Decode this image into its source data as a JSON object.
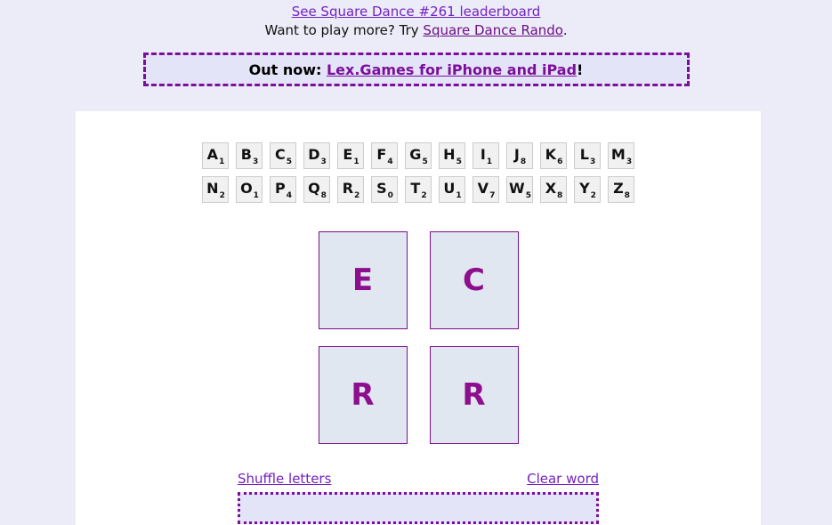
{
  "promo": {
    "leaderboard_link": "See Square Dance #261 leaderboard",
    "play_more_prefix": "Want to play more? Try ",
    "rando_link": "Square Dance Rando",
    "play_more_suffix": ".",
    "banner_prefix": "Out now: ",
    "banner_link": "Lex.Games for iPhone and iPad",
    "banner_suffix": "!"
  },
  "rack": {
    "row1": [
      {
        "letter": "A",
        "value": "1"
      },
      {
        "letter": "B",
        "value": "3"
      },
      {
        "letter": "C",
        "value": "5"
      },
      {
        "letter": "D",
        "value": "3"
      },
      {
        "letter": "E",
        "value": "1"
      },
      {
        "letter": "F",
        "value": "4"
      },
      {
        "letter": "G",
        "value": "5"
      },
      {
        "letter": "H",
        "value": "5"
      },
      {
        "letter": "I",
        "value": "1"
      },
      {
        "letter": "J",
        "value": "8"
      },
      {
        "letter": "K",
        "value": "6"
      },
      {
        "letter": "L",
        "value": "3"
      },
      {
        "letter": "M",
        "value": "3"
      }
    ],
    "row2": [
      {
        "letter": "N",
        "value": "2"
      },
      {
        "letter": "O",
        "value": "1"
      },
      {
        "letter": "P",
        "value": "4"
      },
      {
        "letter": "Q",
        "value": "8"
      },
      {
        "letter": "R",
        "value": "2"
      },
      {
        "letter": "S",
        "value": "0"
      },
      {
        "letter": "T",
        "value": "2"
      },
      {
        "letter": "U",
        "value": "1"
      },
      {
        "letter": "V",
        "value": "7"
      },
      {
        "letter": "W",
        "value": "5"
      },
      {
        "letter": "X",
        "value": "8"
      },
      {
        "letter": "Y",
        "value": "2"
      },
      {
        "letter": "Z",
        "value": "8"
      }
    ]
  },
  "board": {
    "row1": [
      {
        "letter": "E"
      },
      {
        "letter": "C"
      }
    ],
    "row2": [
      {
        "letter": "R"
      },
      {
        "letter": "R"
      }
    ]
  },
  "controls": {
    "shuffle_label": "Shuffle letters",
    "clear_label": "Clear word",
    "word_value": ""
  },
  "colors": {
    "page_background": "#ececf8",
    "card_background": "#ffffff",
    "accent_purple": "#7b0f9b",
    "link_purple": "#7322c0",
    "board_letter": "#8e0f8e",
    "board_tile_fill": "#e1e7f0",
    "rack_tile_fill": "#f1f1f1"
  }
}
